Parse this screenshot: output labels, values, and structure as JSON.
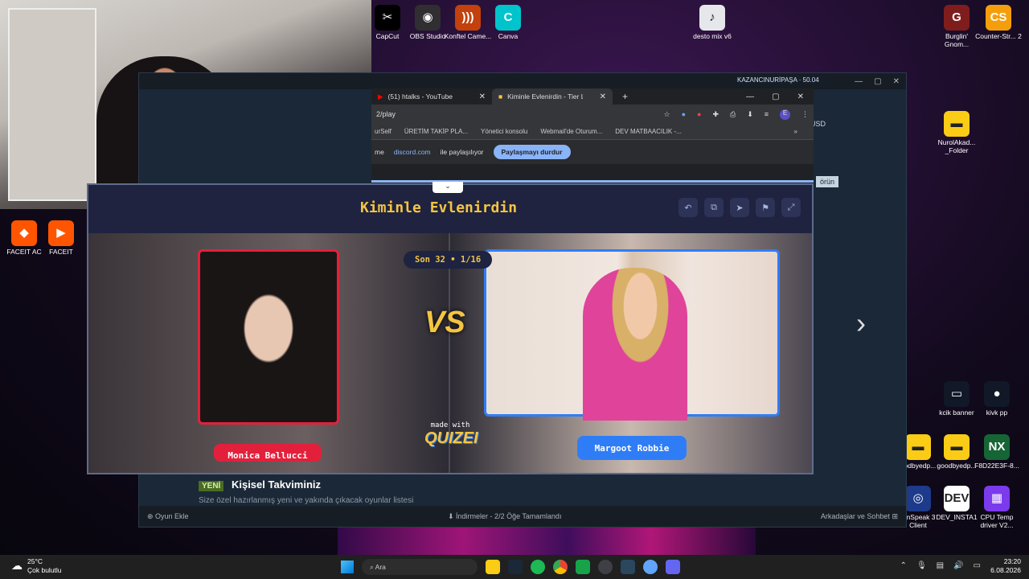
{
  "desktop": {
    "icons": [
      {
        "id": "capcut",
        "label": "CapCut",
        "color": "#000000",
        "glyph": "✂"
      },
      {
        "id": "obs",
        "label": "OBS Studio",
        "color": "#302e31",
        "glyph": "◉"
      },
      {
        "id": "konftel",
        "label": "Konftel Came...",
        "color": "#c2410c",
        "glyph": ")))"
      },
      {
        "id": "canva",
        "label": "Canva",
        "color": "#00c4cc",
        "glyph": "C"
      },
      {
        "id": "desto",
        "label": "desto mix v6",
        "color": "#e5e7eb",
        "glyph": "♪"
      },
      {
        "id": "burglin",
        "label": "Burglin' Gnom...",
        "color": "#7f1d1d",
        "glyph": "G"
      },
      {
        "id": "cs2",
        "label": "Counter-Str... 2",
        "color": "#f59e0b",
        "glyph": "CS"
      },
      {
        "id": "faceitac",
        "label": "FACEIT AC",
        "color": "#ff5500",
        "glyph": "◆"
      },
      {
        "id": "faceit",
        "label": "FACEIT",
        "color": "#ff5500",
        "glyph": "▶"
      },
      {
        "id": "nurolfolder",
        "label": "NurolAkad... _Folder",
        "color": "#facc15",
        "glyph": "▬"
      },
      {
        "id": "kcik",
        "label": "kcik banner",
        "color": "#111827",
        "glyph": "▭"
      },
      {
        "id": "kivk",
        "label": "kivk pp",
        "color": "#111827",
        "glyph": "●"
      },
      {
        "id": "goodbye1",
        "label": "oodbyedp...",
        "color": "#facc15",
        "glyph": "▬"
      },
      {
        "id": "goodbye2",
        "label": "goodbyedp...",
        "color": "#facc15",
        "glyph": "▬"
      },
      {
        "id": "f8d",
        "label": "F8D22E3F-8...",
        "color": "#166534",
        "glyph": "NX"
      },
      {
        "id": "ts",
        "label": "amSpeak 3 Client",
        "color": "#1e3a8a",
        "glyph": "◎"
      },
      {
        "id": "devinsta",
        "label": "DEV_INSTA1",
        "color": "#ffffff",
        "glyph": "DEV"
      },
      {
        "id": "cputemp",
        "label": "CPU Temp driver V2...",
        "color": "#7c3aed",
        "glyph": "▦"
      }
    ]
  },
  "steam": {
    "user": "KAZANCINURİPAŞA",
    "balance": "50.04",
    "currency": "USD",
    "side_button": "örün",
    "promo_badge": "YENİ",
    "promo_title": "Kişisel Takviminiz",
    "promo_sub": "Size özel hazırlanmış yeni ve yakında çıkacak oyunlar listesi",
    "add_game": "Oyun Ekle",
    "downloads": "İndirmeler - 2/2 Öğe Tamamlandı",
    "friends": "Arkadaşlar ve Sohbet"
  },
  "browser": {
    "tabs": [
      {
        "label": "(51) htalks - YouTube",
        "active": false
      },
      {
        "label": "Kiminle Evlenirdin - Tier List",
        "active": true
      }
    ],
    "new_tab": "+",
    "url": "2/play",
    "bookmarks": [
      "urSelf",
      "ÜRETİM TAKİP PLA...",
      "Yönetici konsolu",
      "Webmail'de Oturum...",
      "DEV MATBAACILIK -..."
    ],
    "share_prefix": "me",
    "share_site": "discord.com",
    "share_text": "ile paylaşılıyor",
    "share_stop": "Paylaşmayı durdur",
    "profile_initial": "E"
  },
  "game": {
    "title": "Kiminle Evlenirdin",
    "round": "Son 32 • 1/16",
    "vs": "VS",
    "made_with": "made with",
    "brand": "QUIZEI",
    "left_name": "Monica Bellucci",
    "right_name": "Margoot Robbie",
    "accent": "#f4c542",
    "left_color": "#e3203b",
    "right_color": "#2f7df6"
  },
  "taskbar": {
    "temp": "25°C",
    "weather": "Çok bulutlu",
    "search": "Ara",
    "time": "23:20",
    "date": "6.08.2026"
  }
}
